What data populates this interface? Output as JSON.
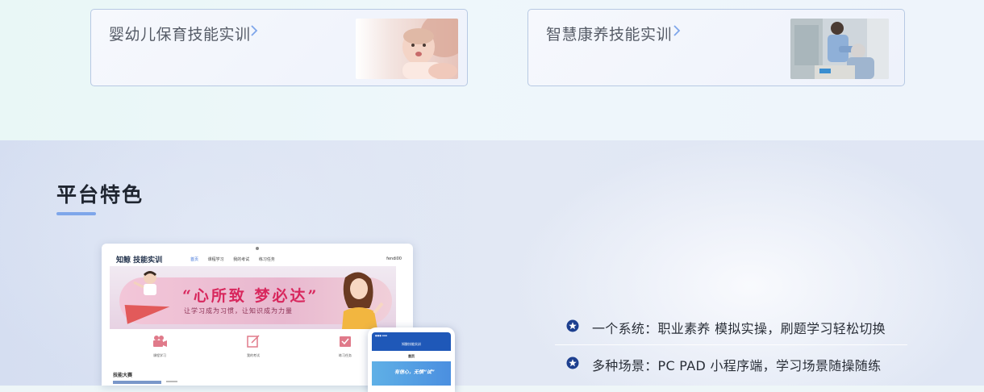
{
  "top_cards": [
    {
      "title": "婴幼儿保育技能实训"
    },
    {
      "title": "智慧康养技能实训"
    }
  ],
  "section": {
    "title": "平台特色"
  },
  "mock_desktop": {
    "brand": "知鲸 技能实训",
    "nav": [
      "首页",
      "课程学习",
      "我的考试",
      "练习任务"
    ],
    "user": "fendi00",
    "banner_main": "“心所致 梦必达”",
    "banner_sub": "让学习成为习惯，让知识成为力量",
    "features": [
      "课程学习",
      "我的考试",
      "练习任务"
    ],
    "contest_label": "技能大赛"
  },
  "mock_phone": {
    "title": "知鲸技能实训",
    "home": "首页",
    "banner_text": "有信心，无惧“试”"
  },
  "features": [
    {
      "text": "一个系统：职业素养 模拟实操，刷题学习轻松切换"
    },
    {
      "text": "多种场景：PC PAD 小程序端，学习场景随操随练"
    }
  ],
  "colors": {
    "accent": "#7ea6ea",
    "feature_icon": "#1d3f8f",
    "card_border": "#b7c9e3"
  }
}
